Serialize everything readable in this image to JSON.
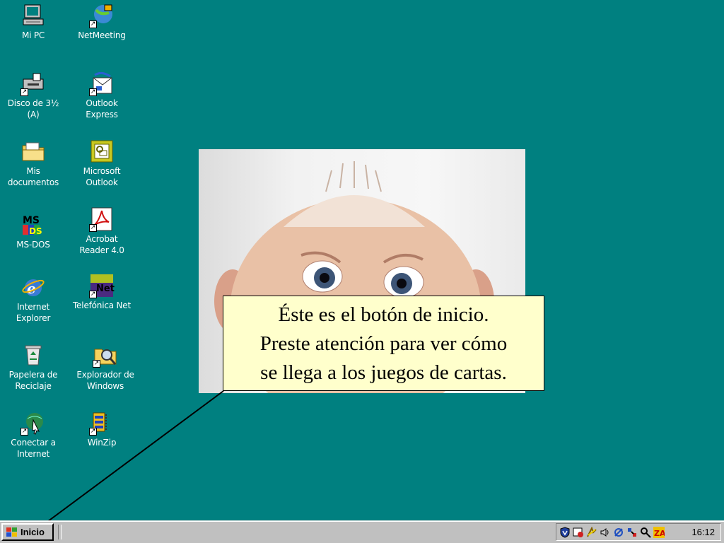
{
  "desktop": {
    "icons": [
      {
        "label": "Mi PC",
        "icon": "my-computer-icon"
      },
      {
        "label": "NetMeeting",
        "icon": "netmeeting-icon"
      },
      {
        "label": "Disco de 3½\n(A)",
        "icon": "floppy-drive-icon"
      },
      {
        "label": "Outlook\nExpress",
        "icon": "outlook-express-icon"
      },
      {
        "label": "Mis\ndocumentos",
        "icon": "my-documents-icon"
      },
      {
        "label": "Microsoft\nOutlook",
        "icon": "microsoft-outlook-icon"
      },
      {
        "label": "MS-DOS",
        "icon": "ms-dos-icon"
      },
      {
        "label": "Acrobat\nReader 4.0",
        "icon": "acrobat-reader-icon"
      },
      {
        "label": "Internet\nExplorer",
        "icon": "internet-explorer-icon"
      },
      {
        "label": "Telefónica Net",
        "icon": "telefonica-net-icon"
      },
      {
        "label": "Papelera de\nReciclaje",
        "icon": "recycle-bin-icon"
      },
      {
        "label": "Explorador de\nWindows",
        "icon": "windows-explorer-icon"
      },
      {
        "label": "Conectar a\nInternet",
        "icon": "connect-internet-icon"
      },
      {
        "label": "WinZip",
        "icon": "winzip-icon"
      }
    ],
    "background_color": "#008080"
  },
  "callout": {
    "lines": [
      "Éste es el botón de inicio.",
      "Preste atención para ver cómo",
      "se llega a los juegos de cartas."
    ],
    "background_color": "#ffffcc"
  },
  "taskbar": {
    "start_label": "Inicio",
    "clock": "16:12",
    "tray_icons": [
      "antivirus-shield-icon",
      "schedule-icon",
      "connection-icon",
      "volume-icon",
      "network-icon",
      "tools-icon",
      "search-tray-icon",
      "zonealarm-icon"
    ]
  }
}
